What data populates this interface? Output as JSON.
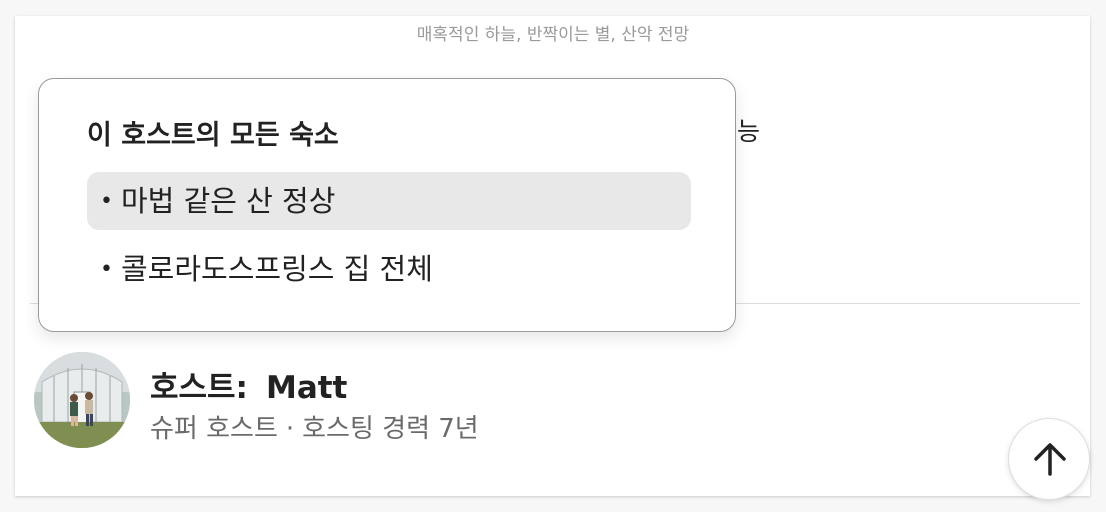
{
  "listing": {
    "subtitle": "매혹적인 하늘, 반짝이는 별, 산악 전망",
    "hidden_fragment": "능"
  },
  "dropdown": {
    "title": "이 호스트의 모든 숙소",
    "items": [
      {
        "label": "마법 같은 산 정상",
        "highlighted": true
      },
      {
        "label": "콜로라도스프링스 집 전체",
        "highlighted": false
      }
    ]
  },
  "host": {
    "label": "호스트:",
    "name": "Matt",
    "badge": "슈퍼 호스트",
    "separator": "·",
    "experience": "호스팅 경력 7년"
  },
  "icons": {
    "bullet": "•",
    "scroll_top": "arrow-up-icon"
  },
  "colors": {
    "highlight": "#e8e8e8",
    "border": "#9a9a9a",
    "muted_text": "#6a6a6a"
  }
}
